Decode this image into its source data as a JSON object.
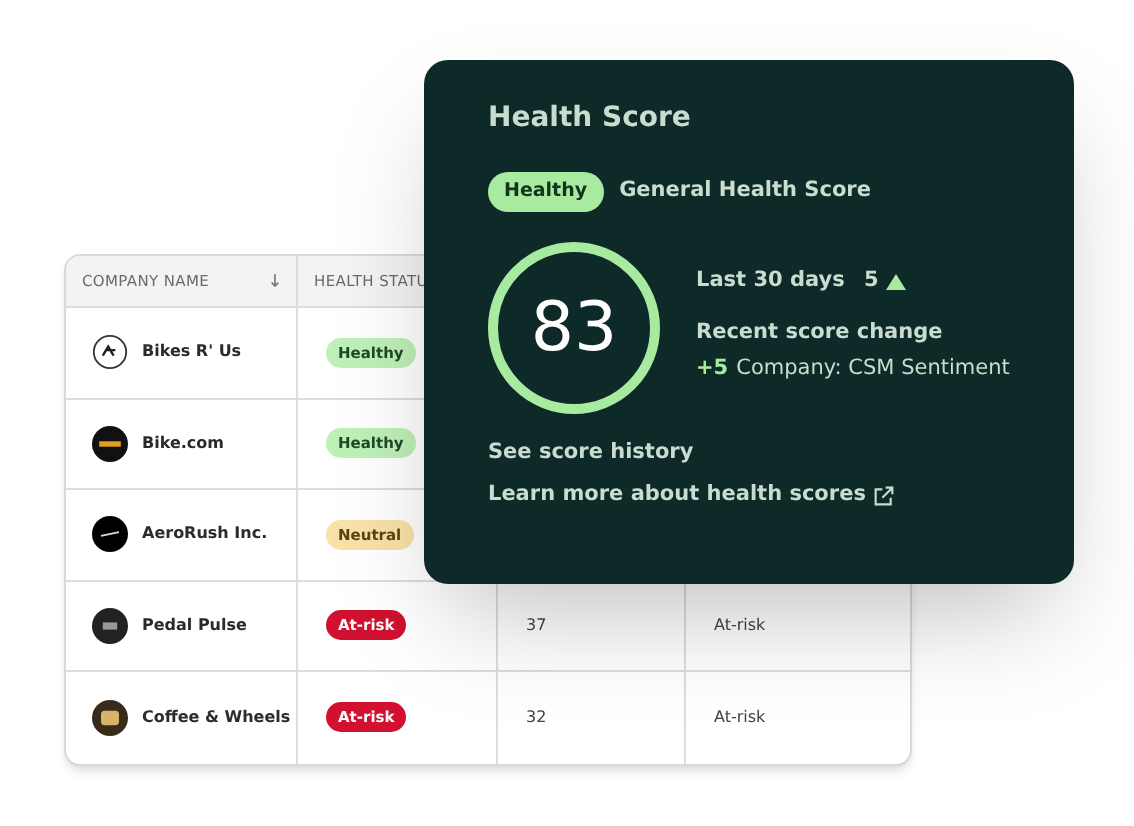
{
  "table": {
    "columns": [
      {
        "label": "COMPANY NAME",
        "sort_descending": true
      },
      {
        "label": "HEALTH STATU"
      }
    ],
    "rows": [
      {
        "company": "Bikes R' Us",
        "status": {
          "label": "Healthy",
          "kind": "healthy"
        }
      },
      {
        "company": "Bike.com",
        "status": {
          "label": "Healthy",
          "kind": "healthy"
        }
      },
      {
        "company": "AeroRush Inc.",
        "status": {
          "label": "Neutral",
          "kind": "neutral"
        }
      },
      {
        "company": "Pedal Pulse",
        "status": {
          "label": "At-risk",
          "kind": "at_risk"
        },
        "score": "37",
        "category": "At-risk"
      },
      {
        "company": "Coffee & Wheels",
        "status": {
          "label": "At-risk",
          "kind": "at_risk"
        },
        "score": "32",
        "category": "At-risk"
      }
    ]
  },
  "popup": {
    "title": "Health Score",
    "badge": "Healthy",
    "subtitle": "General Health Score",
    "score": "83",
    "period": "Last 30 days",
    "change": "5",
    "trend_up": true,
    "recent_label": "Recent score change",
    "recent_delta": "+5",
    "recent_source": "Company: CSM Sentiment",
    "links": [
      "See score history",
      "Learn more about health scores"
    ]
  }
}
